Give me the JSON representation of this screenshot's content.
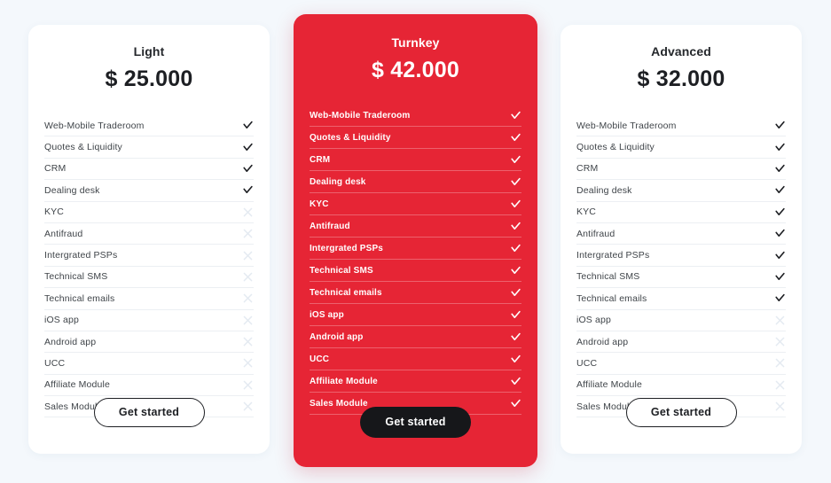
{
  "theme": {
    "page_background": "#f4f8fc",
    "featured_color": "#e62535",
    "ink": "#1d1f23",
    "muted_mark": "#e4eaf1"
  },
  "features": [
    "Web-Mobile Traderoom",
    "Quotes & Liquidity",
    "CRM",
    "Dealing desk",
    "KYC",
    "Antifraud",
    "Intergrated PSPs",
    "Technical SMS",
    "Technical emails",
    "iOS app",
    "Android app",
    "UCC",
    "Affiliate Module",
    "Sales Module"
  ],
  "icons": {
    "included": "check-icon",
    "excluded": "cross-icon"
  },
  "plans": [
    {
      "id": "light",
      "name": "Light",
      "price": "$ 25.000",
      "featured": false,
      "cta_label": "Get started",
      "included": [
        true,
        true,
        true,
        true,
        false,
        false,
        false,
        false,
        false,
        false,
        false,
        false,
        false,
        false
      ]
    },
    {
      "id": "turnkey",
      "name": "Turnkey",
      "price": "$ 42.000",
      "featured": true,
      "cta_label": "Get started",
      "included": [
        true,
        true,
        true,
        true,
        true,
        true,
        true,
        true,
        true,
        true,
        true,
        true,
        true,
        true
      ]
    },
    {
      "id": "advanced",
      "name": "Advanced",
      "price": "$ 32.000",
      "featured": false,
      "cta_label": "Get started",
      "included": [
        true,
        true,
        true,
        true,
        true,
        true,
        true,
        true,
        true,
        false,
        false,
        false,
        false,
        false
      ]
    }
  ]
}
